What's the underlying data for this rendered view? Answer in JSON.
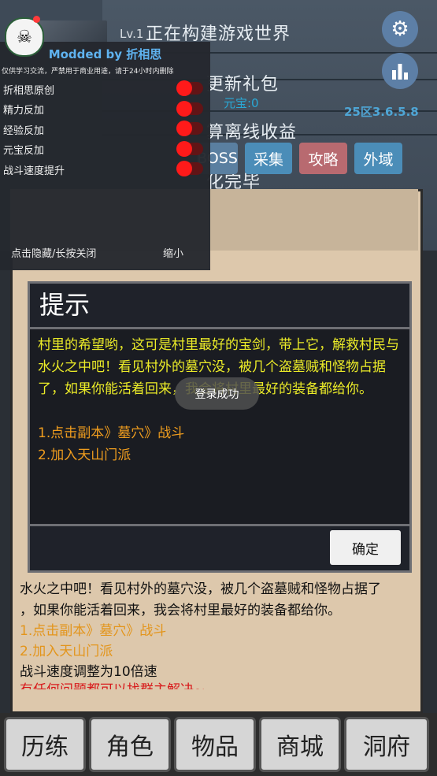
{
  "header": {
    "level_text": "Lv.1",
    "build_status": "正在构建游戏世界",
    "gift": "更新礼包",
    "yuanbao": "元宝:0",
    "server": "25区3.6.5.8",
    "offline": "算离线收益",
    "loaded": "化完毕",
    "returned": "回来",
    "settings_icon": "gear-icon",
    "rank_icon": "bar-chart-icon",
    "buttons": [
      "BOSS",
      "采集",
      "攻略",
      "外域"
    ]
  },
  "mod_menu": {
    "title": "Modded by 折相思",
    "subtitle": "仅供学习交流，严禁用于商业用途，请于24小时内删除",
    "options": [
      {
        "label": "折相思原创",
        "on": true
      },
      {
        "label": "精力反加",
        "on": true
      },
      {
        "label": "经验反加",
        "on": true
      },
      {
        "label": "元宝反加",
        "on": true
      },
      {
        "label": "战斗速度提升",
        "on": true
      }
    ],
    "hide_label": "点击隐藏/长按关闭",
    "minimize_label": "缩小"
  },
  "dialog": {
    "title": "提示",
    "message": "村里的希望哟，这可是村里最好的宝剑，带上它，解救村民与水火之中吧！看见村外的墓穴没，被几个盗墓贼和怪物占据了，如果你能活着回来，我会将村里最好的装备都给你。",
    "steps": [
      "1.点击副本》墓穴》战斗",
      "2.加入天山门派"
    ],
    "confirm": "确定"
  },
  "toast": "登录成功",
  "log": {
    "line1": "水火之中吧！看见村外的墓穴没，被几个盗墓贼和怪物占据了",
    "line2": "，如果你能活着回来，我会将村里最好的装备都给你。",
    "step1": "1.点击副本》墓穴》战斗",
    "step2": "2.加入天山门派",
    "speed": "战斗速度调整为10倍速",
    "help": "有任何问题都可以找群主解决~"
  },
  "nav": [
    "历练",
    "角色",
    "物品",
    "商城",
    "洞府"
  ]
}
